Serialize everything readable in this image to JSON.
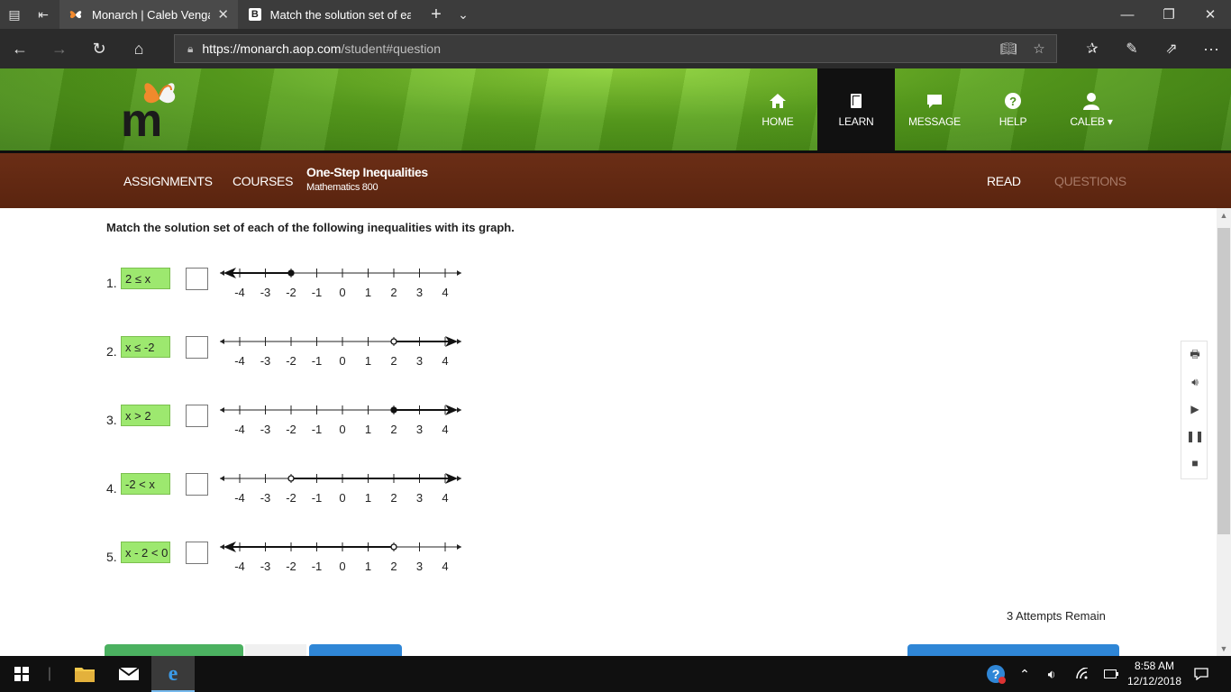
{
  "browser": {
    "tabs": [
      {
        "title": "Monarch | Caleb Vengar",
        "active": true,
        "favicon": "butterfly-icon"
      },
      {
        "title": "Match the solution set of ea",
        "active": false,
        "favicon": "b-icon",
        "favicon_letter": "B"
      }
    ],
    "url_host": "https://monarch.aop.com",
    "url_path": "/student#question"
  },
  "site": {
    "logo_letter": "m",
    "topnav": [
      {
        "label": "HOME",
        "icon": "home-icon"
      },
      {
        "label": "LEARN",
        "icon": "book-icon",
        "active": true
      },
      {
        "label": "MESSAGE",
        "icon": "message-icon"
      },
      {
        "label": "HELP",
        "icon": "help-icon"
      },
      {
        "label": "CALEB ▾",
        "icon": "user-icon"
      }
    ],
    "subnav": {
      "assignments": "ASSIGNMENTS",
      "courses": "COURSES",
      "course_title": "One-Step Inequalities",
      "course_subtitle": "Mathematics 800",
      "read": "READ",
      "questions": "QUESTIONS"
    }
  },
  "question": {
    "instruction": "Match the solution set of each of the following inequalities with its graph.",
    "ticks": [
      "-4",
      "-3",
      "-2",
      "-1",
      "0",
      "1",
      "2",
      "3",
      "4"
    ],
    "items": [
      {
        "num": "1.",
        "inequality": "2 ≤ x",
        "graph": {
          "point": -2,
          "filled": true,
          "direction": "left"
        }
      },
      {
        "num": "2.",
        "inequality": "x ≤ -2",
        "graph": {
          "point": 2,
          "filled": false,
          "direction": "right"
        }
      },
      {
        "num": "3.",
        "inequality": "x > 2",
        "graph": {
          "point": 2,
          "filled": true,
          "direction": "right"
        }
      },
      {
        "num": "4.",
        "inequality": "-2 < x",
        "graph": {
          "point": -2,
          "filled": false,
          "direction": "right"
        }
      },
      {
        "num": "5.",
        "inequality": "x - 2 < 0",
        "graph": {
          "point": 2,
          "filled": false,
          "direction": "left"
        }
      }
    ],
    "attempts": "3 Attempts Remain"
  },
  "taskbar": {
    "time": "8:58 AM",
    "date": "12/12/2018"
  }
}
